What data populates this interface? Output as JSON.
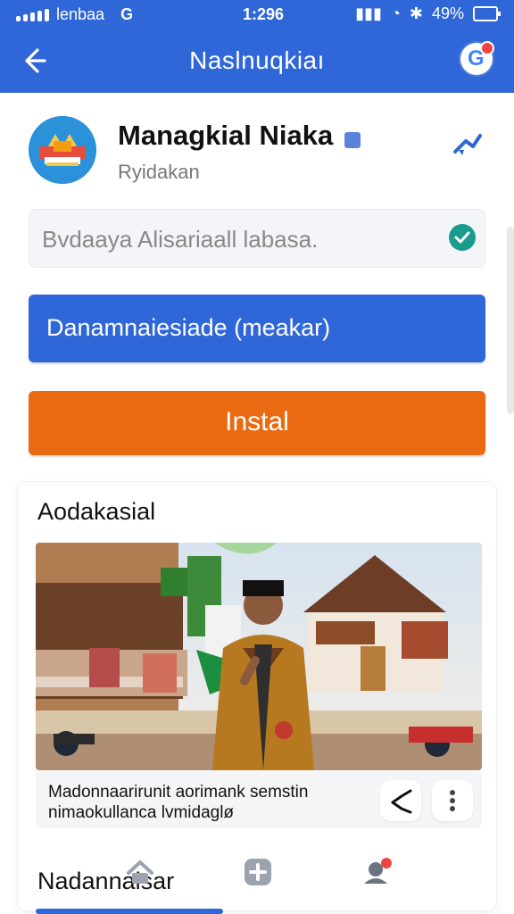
{
  "status_bar": {
    "left_text": "lenbaa",
    "left_badge": "G",
    "time": "1:296",
    "network": "?",
    "battery": "49%"
  },
  "app_bar": {
    "title": "Naslnuqkiaı"
  },
  "app_info": {
    "name": "Managkial Niaka",
    "subtitle": "Ryidakan"
  },
  "search": {
    "value": "Bvdaaya Alisariaall labasa."
  },
  "buttons": {
    "primary_label": "Danamnaiesiade (meakar)",
    "install_label": "Instal"
  },
  "section": {
    "title": "Aodakasial",
    "caption": "Madonnaarirunit aorimank semstin nimaokullanca lvmidaglø"
  },
  "bottom": {
    "label": "Nadannaisar"
  },
  "colors": {
    "primary": "#2f67d8",
    "install": "#ea6a12",
    "verified": "#5a84dc",
    "check": "#189c8e"
  },
  "icons": {
    "back": "back-icon",
    "avatar": "avatar-icon",
    "verified": "verified-icon",
    "pin": "pin-icon",
    "check": "check-icon",
    "share": "share-icon",
    "more": "more-icon",
    "home": "home-icon",
    "add": "add-icon",
    "profile": "profile-icon"
  }
}
